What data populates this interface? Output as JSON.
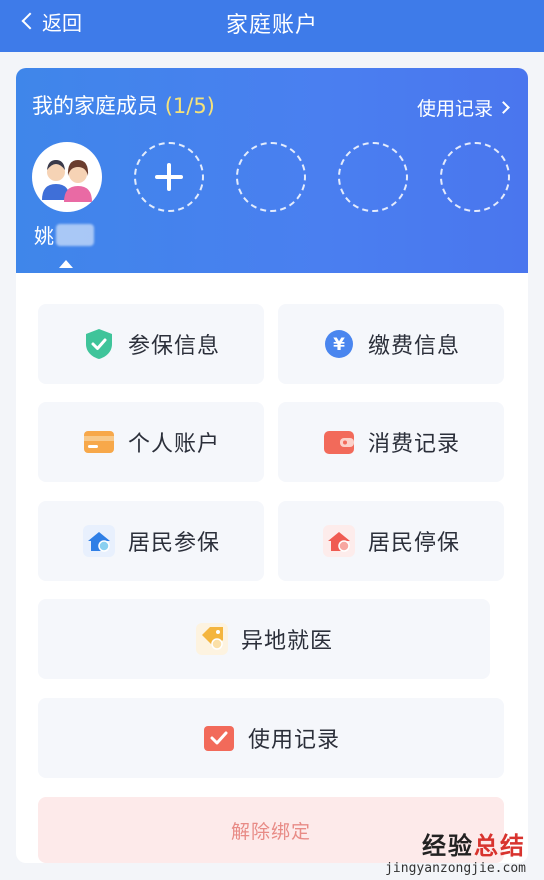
{
  "header": {
    "back_label": "返回",
    "title": "家庭账户"
  },
  "family": {
    "title": "我的家庭成员",
    "count": "(1/5)",
    "records_link": "使用记录",
    "member_name": "姚"
  },
  "tiles": {
    "insurance_info": "参保信息",
    "payment_info": "缴费信息",
    "personal_account": "个人账户",
    "consumption_records": "消费记录",
    "resident_insure": "居民参保",
    "resident_stop": "居民停保",
    "offsite_medical": "异地就医",
    "usage_records": "使用记录"
  },
  "unbind_label": "解除绑定",
  "watermark": {
    "part1": "经验",
    "part2": "总结",
    "url": "jingyanzongjie.com"
  },
  "colors": {
    "brand_blue": "#3e7be9",
    "danger_bg": "#fdeaea",
    "danger_text": "#e88b86"
  },
  "icons": [
    "back-chevron-icon",
    "chevron-right-icon",
    "plus-icon",
    "shield-check-icon",
    "yen-coin-icon",
    "card-icon",
    "wallet-icon",
    "house-insure-icon",
    "house-stop-icon",
    "tag-medical-icon",
    "checkbox-record-icon"
  ]
}
